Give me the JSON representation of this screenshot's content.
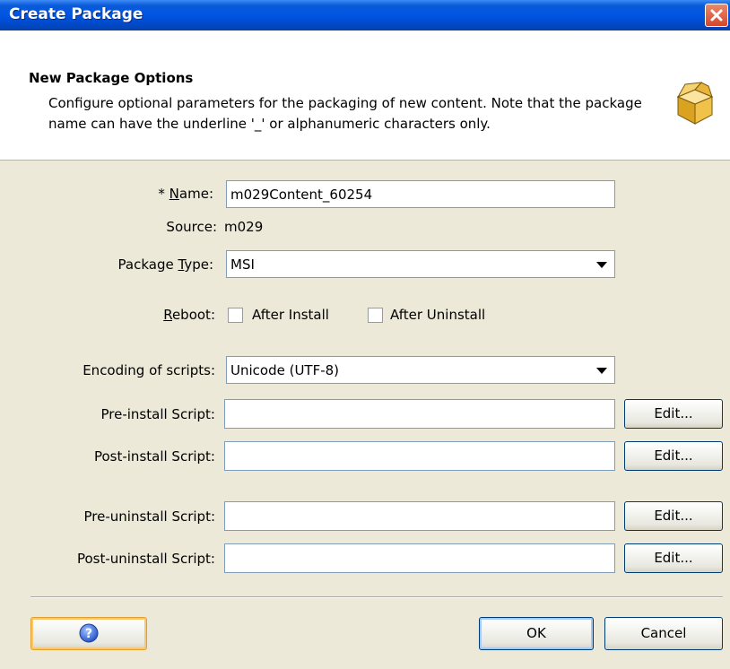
{
  "window": {
    "title": "Create Package"
  },
  "header": {
    "title": "New Package Options",
    "description": "Configure optional parameters for the packaging of new content.  Note that the package name can have the underline '_' or alphanumeric characters only."
  },
  "form": {
    "name": {
      "label_prefix": "* ",
      "label_mnemonic": "N",
      "label_rest": "ame:",
      "value": "m029Content_60254"
    },
    "source": {
      "label": "Source:",
      "value": "m029"
    },
    "package_type": {
      "label_prefix": "Package ",
      "label_mnemonic": "T",
      "label_rest": "ype:",
      "value": "MSI"
    },
    "reboot": {
      "label_mnemonic": "R",
      "label_rest": "eboot:",
      "after_install": {
        "label": "After Install",
        "checked": false
      },
      "after_uninstall": {
        "label": "After Uninstall",
        "checked": false
      }
    },
    "encoding": {
      "label": "Encoding of scripts:",
      "value": "Unicode (UTF-8)"
    },
    "pre_install": {
      "label": "Pre-install Script:",
      "value": "",
      "edit_label": "Edit..."
    },
    "post_install": {
      "label": "Post-install Script:",
      "value": "",
      "edit_label": "Edit..."
    },
    "pre_uninstall": {
      "label": "Pre-uninstall Script:",
      "value": "",
      "edit_label": "Edit..."
    },
    "post_uninstall": {
      "label": "Post-uninstall Script:",
      "value": "",
      "edit_label": "Edit..."
    }
  },
  "footer": {
    "ok_label": "OK",
    "cancel_label": "Cancel"
  },
  "colors": {
    "titlebar": "#0054e3",
    "dialog_bg": "#ece9d8",
    "close_button": "#d6462b",
    "field_border": "#7f9db9"
  },
  "icons": {
    "close": "close-icon",
    "package": "package-box-icon",
    "help": "help-icon",
    "dropdown": "chevron-down-icon"
  }
}
